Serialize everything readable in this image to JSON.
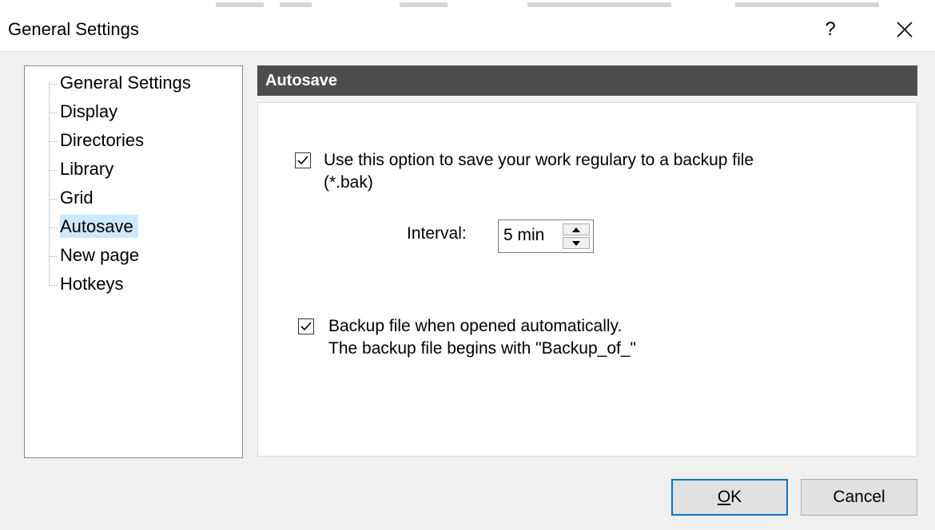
{
  "window": {
    "title": "General Settings",
    "help_label": "?"
  },
  "tree": {
    "items": [
      {
        "label": "General Settings"
      },
      {
        "label": "Display"
      },
      {
        "label": "Directories"
      },
      {
        "label": "Library"
      },
      {
        "label": "Grid"
      },
      {
        "label": "Autosave",
        "selected": true
      },
      {
        "label": "New page"
      },
      {
        "label": "Hotkeys"
      }
    ]
  },
  "panel": {
    "header": "Autosave",
    "autosave_option": {
      "checked": true,
      "line1": "Use this option to save your work regulary to a backup file",
      "line2": "(*.bak)"
    },
    "interval": {
      "label": "Interval:",
      "value": "5 min"
    },
    "backup_option": {
      "checked": true,
      "line1": "Backup file when opened automatically.",
      "line2": "The backup file begins with \"Backup_of_\""
    }
  },
  "buttons": {
    "ok_label": "OK",
    "ok_mnemonic": "O",
    "ok_rest": "K",
    "cancel_label": "Cancel"
  },
  "colors": {
    "panel_header_bg": "#4d4d4d",
    "selection_bg": "#cce8ff",
    "default_button_border": "#0078d7"
  },
  "icons": {
    "help": "question-mark",
    "close": "close-x",
    "checkbox": "checkmark",
    "spin_up": "triangle-up",
    "spin_down": "triangle-down"
  }
}
